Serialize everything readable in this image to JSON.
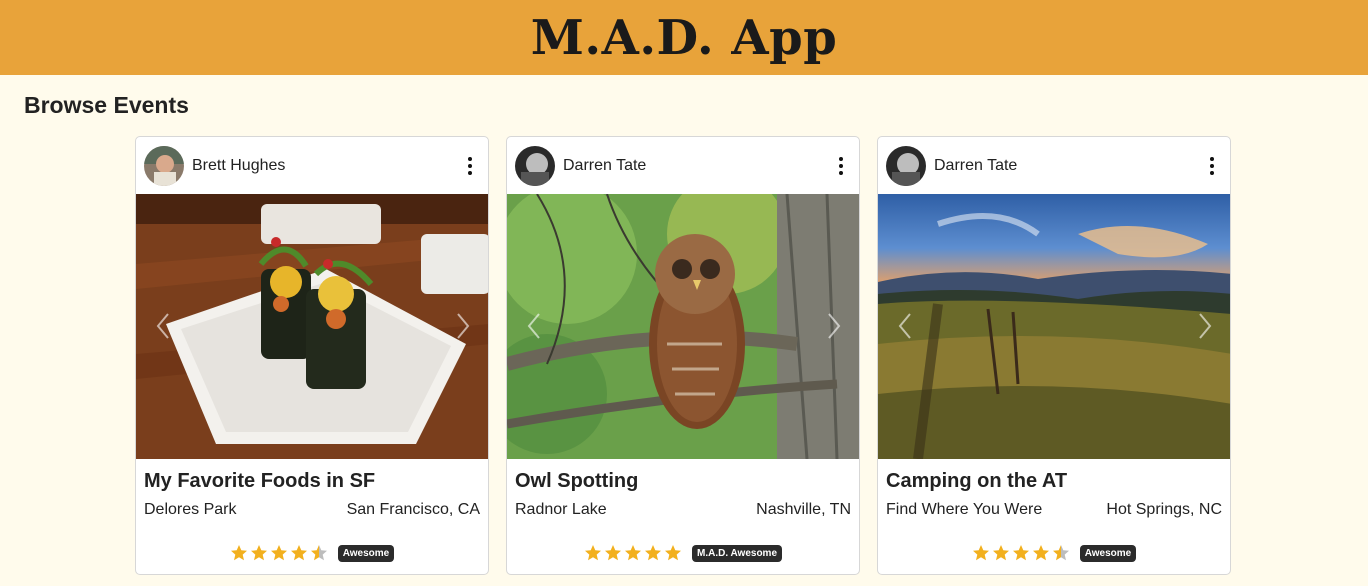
{
  "app": {
    "title": "M.A.D. App"
  },
  "page": {
    "section_title": "Browse Events"
  },
  "colors": {
    "header_bg": "#e8a33a",
    "page_bg": "#fffbec",
    "star": "#f2b01e",
    "badge_bg": "#2b2b2b"
  },
  "icons": {
    "menu": "kebab-vertical-icon",
    "prev": "chevron-left-icon",
    "next": "chevron-right-icon",
    "star": "star-icon"
  },
  "events": [
    {
      "user": "Brett Hughes",
      "title": "My Favorite Foods in SF",
      "place": "Delores Park",
      "location": "San Francisco, CA",
      "rating": 4.5,
      "badge": "Awesome"
    },
    {
      "user": "Darren Tate",
      "title": "Owl Spotting",
      "place": "Radnor Lake",
      "location": "Nashville, TN",
      "rating": 5,
      "badge": "M.A.D. Awesome"
    },
    {
      "user": "Darren Tate",
      "title": "Camping on the AT",
      "place": "Find Where You Were",
      "location": "Hot Springs, NC",
      "rating": 4.5,
      "badge": "Awesome"
    }
  ]
}
